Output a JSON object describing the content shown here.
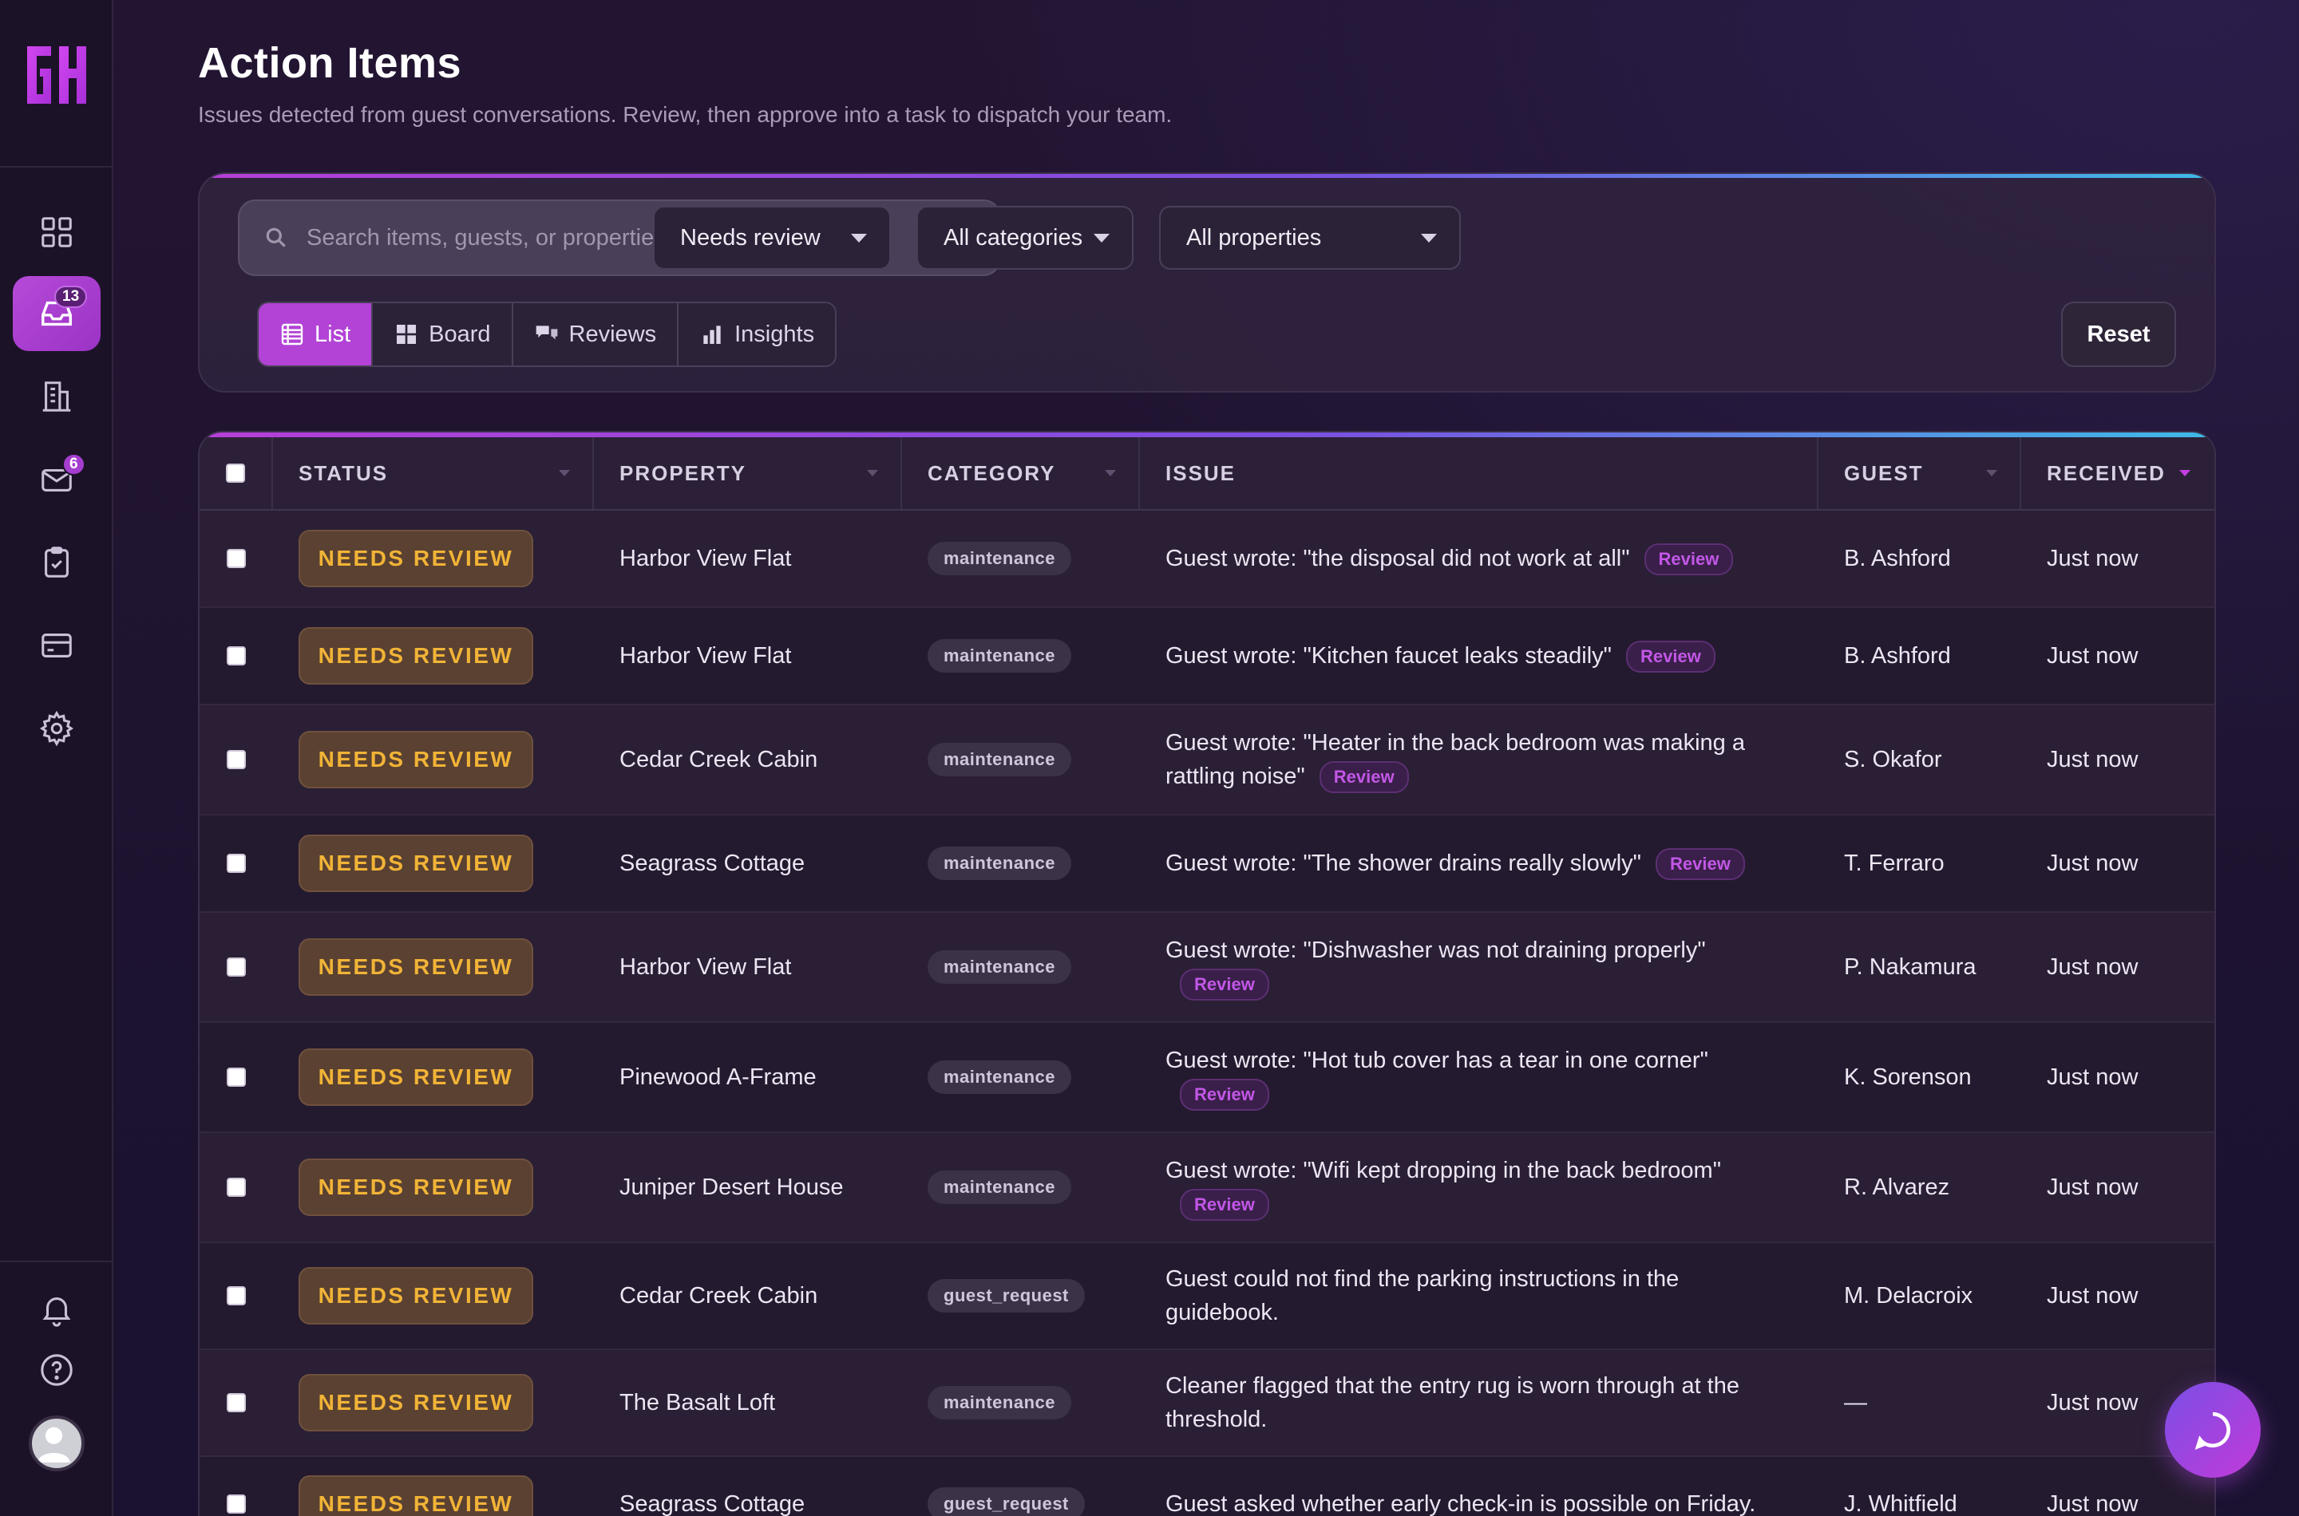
{
  "brand": {
    "logo_text": "GH"
  },
  "sidebar": {
    "inbox_badge": "13",
    "mail_badge": "6"
  },
  "header": {
    "title": "Action Items",
    "subtitle": "Issues detected from guest conversations. Review, then approve into a task to dispatch your team."
  },
  "filters": {
    "search_placeholder": "Search items, guests, or properties...",
    "status_value": "Needs review",
    "category_value": "All categories",
    "property_value": "All properties",
    "reset_label": "Reset"
  },
  "views": [
    {
      "label": "List",
      "icon": "list-icon",
      "active": true
    },
    {
      "label": "Board",
      "icon": "board-icon",
      "active": false
    },
    {
      "label": "Reviews",
      "icon": "reviews-icon",
      "active": false
    },
    {
      "label": "Insights",
      "icon": "insights-icon",
      "active": false
    }
  ],
  "table": {
    "columns": [
      "STATUS",
      "PROPERTY",
      "CATEGORY",
      "ISSUE",
      "GUEST",
      "RECEIVED"
    ],
    "sorted_column": "RECEIVED",
    "review_tag": "Review",
    "rows": [
      {
        "status": "NEEDS REVIEW",
        "property": "Harbor View Flat",
        "category": "maintenance",
        "issue": "Guest wrote: \"the disposal did not work at all\"",
        "review": true,
        "guest": "B. Ashford",
        "received": "Just now"
      },
      {
        "status": "NEEDS REVIEW",
        "property": "Harbor View Flat",
        "category": "maintenance",
        "issue": "Guest wrote: \"Kitchen faucet leaks steadily\"",
        "review": true,
        "guest": "B. Ashford",
        "received": "Just now"
      },
      {
        "status": "NEEDS REVIEW",
        "property": "Cedar Creek Cabin",
        "category": "maintenance",
        "issue": "Guest wrote: \"Heater in the back bedroom was making a rattling noise\"",
        "review": true,
        "guest": "S. Okafor",
        "received": "Just now"
      },
      {
        "status": "NEEDS REVIEW",
        "property": "Seagrass Cottage",
        "category": "maintenance",
        "issue": "Guest wrote: \"The shower drains really slowly\"",
        "review": true,
        "guest": "T. Ferraro",
        "received": "Just now"
      },
      {
        "status": "NEEDS REVIEW",
        "property": "Harbor View Flat",
        "category": "maintenance",
        "issue": "Guest wrote: \"Dishwasher was not draining properly\"",
        "review": true,
        "guest": "P. Nakamura",
        "received": "Just now"
      },
      {
        "status": "NEEDS REVIEW",
        "property": "Pinewood A-Frame",
        "category": "maintenance",
        "issue": "Guest wrote: \"Hot tub cover has a tear in one corner\"",
        "review": true,
        "guest": "K. Sorenson",
        "received": "Just now"
      },
      {
        "status": "NEEDS REVIEW",
        "property": "Juniper Desert House",
        "category": "maintenance",
        "issue": "Guest wrote: \"Wifi kept dropping in the back bedroom\"",
        "review": true,
        "guest": "R. Alvarez",
        "received": "Just now"
      },
      {
        "status": "NEEDS REVIEW",
        "property": "Cedar Creek Cabin",
        "category": "guest_request",
        "issue": "Guest could not find the parking instructions in the guidebook.",
        "review": false,
        "guest": "M. Delacroix",
        "received": "Just now"
      },
      {
        "status": "NEEDS REVIEW",
        "property": "The Basalt Loft",
        "category": "maintenance",
        "issue": "Cleaner flagged that the entry rug is worn through at the threshold.",
        "review": false,
        "guest": "—",
        "received": "Just now"
      },
      {
        "status": "NEEDS REVIEW",
        "property": "Seagrass Cottage",
        "category": "guest_request",
        "issue": "Guest asked whether early check-in is possible on Friday.",
        "review": false,
        "guest": "J. Whitfield",
        "received": "Just now"
      }
    ]
  },
  "colors": {
    "accent": "#b243d6",
    "status_text": "#f2b437",
    "status_bg": "#5a4131",
    "background": "#1d1330"
  }
}
